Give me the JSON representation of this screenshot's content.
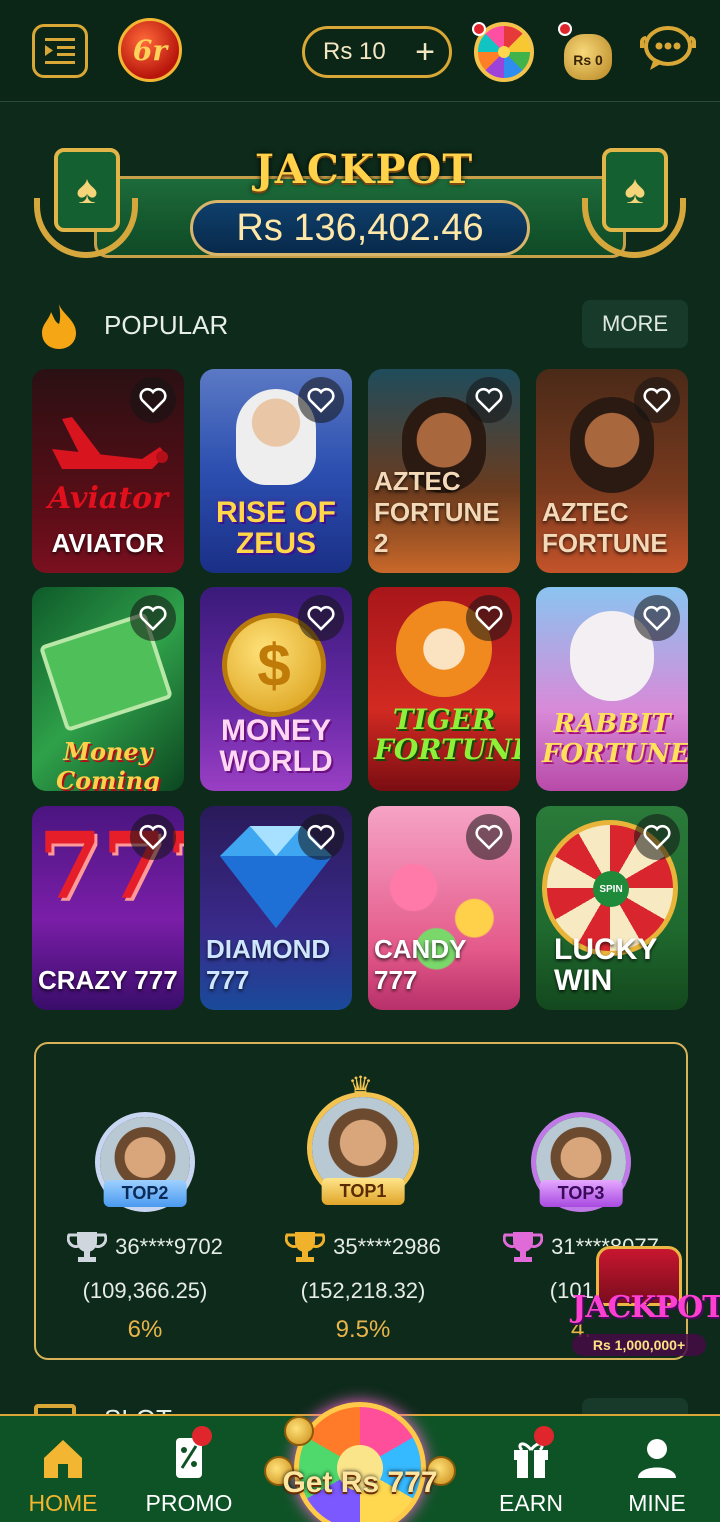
{
  "header": {
    "logo_text": "6r",
    "balance": "Rs 10",
    "balance_add": "+",
    "bag_text": "Rs 0"
  },
  "jackpot": {
    "title": "JACKPOT",
    "amount": "Rs 136,402.46"
  },
  "popular": {
    "title": "POPULAR",
    "more": "MORE",
    "games": [
      {
        "name": "AVIATOR",
        "logo": "Aviator"
      },
      {
        "name": "RISE OF ZEUS",
        "logo": ""
      },
      {
        "name": "AZTEC FORTUNE 2",
        "logo": ""
      },
      {
        "name": "AZTEC FORTUNE",
        "logo": ""
      },
      {
        "name": "",
        "logo": "Money Coming"
      },
      {
        "name": "MONEY WORLD",
        "logo": "$"
      },
      {
        "name": "",
        "logo": "TIGER FORTUNE"
      },
      {
        "name": "",
        "logo": "RABBIT FORTUNE"
      },
      {
        "name": "CRAZY 777",
        "logo": "777"
      },
      {
        "name": "DIAMOND 777",
        "logo": ""
      },
      {
        "name": "CANDY 777",
        "logo": ""
      },
      {
        "name": "LUCKY WIN",
        "logo": "SPIN"
      }
    ]
  },
  "leaderboard": [
    {
      "rank": "TOP2",
      "user": "36****9702",
      "amount": "(109,366.25)",
      "percent": "6%"
    },
    {
      "rank": "TOP1",
      "user": "35****2986",
      "amount": "(152,218.32)",
      "percent": "9.5%"
    },
    {
      "rank": "TOP3",
      "user": "31****8077",
      "amount": "(101,6",
      "percent": "4."
    }
  ],
  "float_jackpot": {
    "title": "JACKPOT",
    "sub": "Rs 1,000,000+"
  },
  "slot_section": {
    "title": "SLOT"
  },
  "bottom_nav": {
    "home": "HOME",
    "promo": "PROMO",
    "center": "Get Rs 777",
    "earn": "EARN",
    "mine": "MINE"
  },
  "colors": {
    "background": "#0d2a1a",
    "accent_gold": "#d9a736",
    "nav_bg": "#0e5326",
    "active_nav": "#f2b632"
  }
}
